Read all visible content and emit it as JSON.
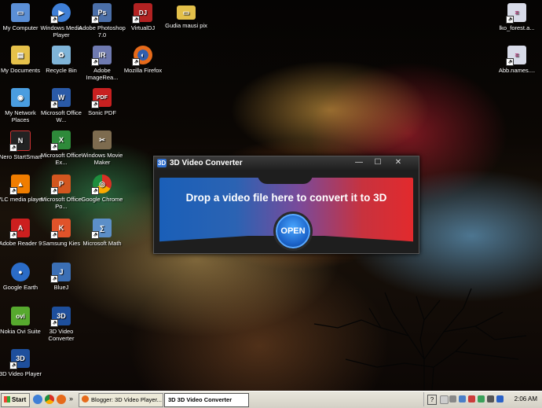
{
  "desktop": {
    "icons": [
      {
        "label": "My Computer",
        "color": "#5b8fd6",
        "glyph": "▭"
      },
      {
        "label": "My Documents",
        "color": "#e6c14a",
        "glyph": "▤"
      },
      {
        "label": "My Network Places",
        "color": "#4a9de0",
        "glyph": "◉"
      },
      {
        "label": "Nero StartSmart",
        "color": "#222222",
        "glyph": "N"
      },
      {
        "label": "VLC media player",
        "color": "#f07d00",
        "glyph": "▲"
      },
      {
        "label": "Adobe Reader 9",
        "color": "#cc1f1f",
        "glyph": "A"
      },
      {
        "label": "Google Earth",
        "color": "#2b6cc7",
        "glyph": "●"
      },
      {
        "label": "Nokia Ovi Suite",
        "color": "#57a92e",
        "glyph": "ovi"
      },
      {
        "label": "3D Video Player",
        "color": "#1e4f9c",
        "glyph": "3D"
      },
      {
        "label": "Windows Media Player",
        "color": "#3f7fd6",
        "glyph": "▶"
      },
      {
        "label": "Recycle Bin",
        "color": "#7fb4d8",
        "glyph": "♻"
      },
      {
        "label": "Microsoft Office W...",
        "color": "#2a5aa8",
        "glyph": "W"
      },
      {
        "label": "Microsoft Office Ex...",
        "color": "#2e8a3a",
        "glyph": "X"
      },
      {
        "label": "Microsoft Office Po...",
        "color": "#d2561f",
        "glyph": "P"
      },
      {
        "label": "Samsung Kies",
        "color": "#e0532a",
        "glyph": "K"
      },
      {
        "label": "BlueJ",
        "color": "#3b6fb5",
        "glyph": "J"
      },
      {
        "label": "3D Video Converter",
        "color": "#1e4f9c",
        "glyph": "3D"
      },
      {
        "label": "Adobe Photoshop 7.0",
        "color": "#4b6fa8",
        "glyph": "Ps"
      },
      {
        "label": "Adobe ImageRea...",
        "color": "#6f7ab0",
        "glyph": "IR"
      },
      {
        "label": "Sonic PDF",
        "color": "#c82020",
        "glyph": "PDF"
      },
      {
        "label": "Windows Movie Maker",
        "color": "#7d6b4f",
        "glyph": "✂"
      },
      {
        "label": "Google Chrome",
        "color": "#2f9e44",
        "glyph": "◎"
      },
      {
        "label": "Microsoft Math",
        "color": "#5c8fc8",
        "glyph": "∑"
      },
      {
        "label": "VirtualDJ",
        "color": "#b22222",
        "glyph": "DJ"
      },
      {
        "label": "Mozilla Firefox",
        "color": "#e66a1a",
        "glyph": "◐"
      },
      {
        "label": "Gudia mausi pix",
        "color": "#e3c04a",
        "glyph": "▭"
      },
      {
        "label": "lko_forest.a...",
        "color": "#d8dbe8",
        "glyph": "≡"
      },
      {
        "label": "Abb.names....",
        "color": "#d8dbe8",
        "glyph": "≡"
      }
    ]
  },
  "window": {
    "title": "3D Video Converter",
    "logo_text": "3D",
    "min_glyph": "—",
    "max_glyph": "☐",
    "close_glyph": "✕",
    "drop_text": "Drop a video file here to convert it to 3D",
    "open_label": "OPEN"
  },
  "taskbar": {
    "start_label": "Start",
    "expand_glyph": "»",
    "tasks": [
      {
        "label": "Blogger: 3D Video Player..."
      },
      {
        "label": "3D 3D Video Converter"
      }
    ],
    "help_glyph": "?",
    "clock": "2:06 AM"
  }
}
